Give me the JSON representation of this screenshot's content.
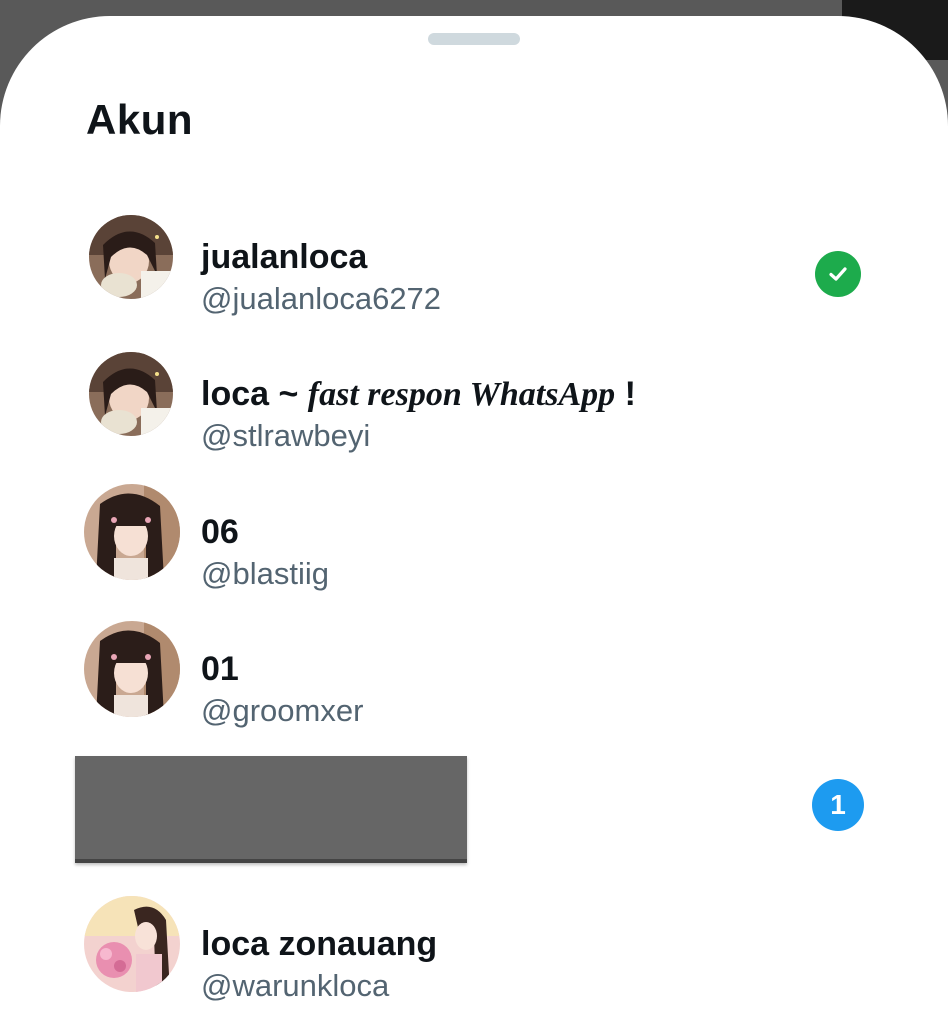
{
  "sheet": {
    "title": "Akun"
  },
  "accounts": [
    {
      "name_prefix": "loca",
      "name": "jualanloca",
      "handle": "@jualanloca6272",
      "status": "selected",
      "status_icon": "check-circle-icon",
      "avatar": "avatar-photo-1"
    },
    {
      "name_prefix": "loca ~ ",
      "name_fancy": "fast respon WhatsApp",
      "name_suffix": " !",
      "handle": "@stlrawbeyi",
      "avatar": "avatar-photo-1"
    },
    {
      "name": "06",
      "handle": "@blastiig",
      "avatar": "avatar-photo-2"
    },
    {
      "name": "01",
      "handle": "@groomxer",
      "avatar": "avatar-photo-2"
    },
    {
      "redacted": true,
      "notification_count": "1"
    },
    {
      "name": "loca zonauang",
      "handle": "@warunkloca",
      "avatar": "avatar-photo-3"
    }
  ],
  "colors": {
    "check": "#1dab4c",
    "badge": "#1d9bf0",
    "handle_text": "#536471",
    "name_text": "#0f1419"
  }
}
